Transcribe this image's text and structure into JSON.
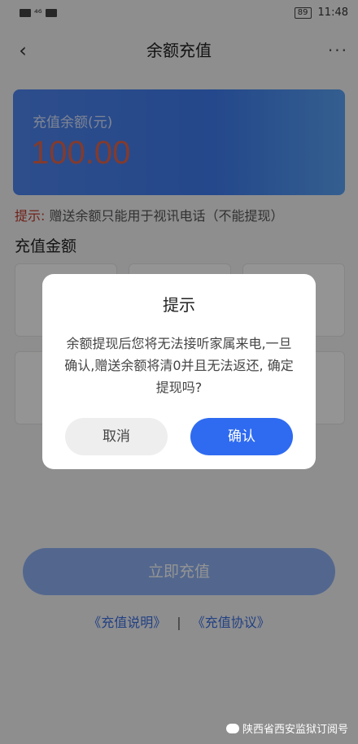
{
  "status_bar": {
    "left_text": "⁴⁶",
    "time": "11:48",
    "battery": "89"
  },
  "nav": {
    "title": "余额充值",
    "back_icon": "‹",
    "more_icon": "···"
  },
  "balance_card": {
    "label": "充值余额(元)",
    "amount": "100.00"
  },
  "tip": {
    "label": "提示:",
    "text": " 赠送余额只能用于视讯电话（不能提现）"
  },
  "section_title": "充值金额",
  "actions": {
    "recharge_label": "立即充值",
    "link_instructions": "《充值说明》",
    "link_separator": "|",
    "link_agreement": "《充值协议》"
  },
  "watermark": {
    "text": "陕西省西安监狱订阅号"
  },
  "dialog": {
    "title": "提示",
    "message": "余额提现后您将无法接听家属来电,一旦确认,赠送余额将清0并且无法返还, 确定提现吗?",
    "cancel_label": "取消",
    "confirm_label": "确认"
  },
  "colors": {
    "accent": "#2f6bf0",
    "card_gradient_start": "#4f86ef",
    "amount_color": "#e2664e",
    "tip_label": "#c23b2a"
  }
}
